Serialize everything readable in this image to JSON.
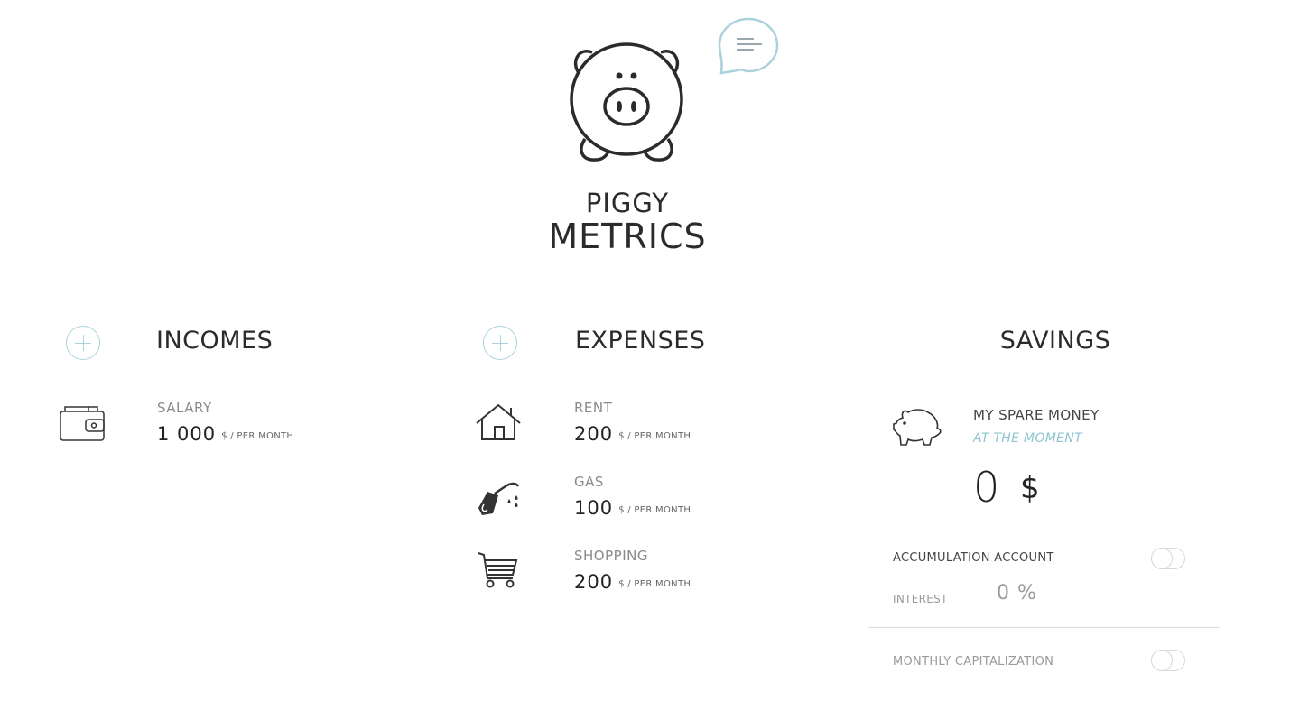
{
  "brand": {
    "line1": "PIGGY",
    "line2": "METRICS"
  },
  "incomes": {
    "title": "INCOMES",
    "items": [
      {
        "name": "SALARY",
        "amount": "1 000",
        "unit": "$ / PER MONTH",
        "icon": "wallet-icon"
      }
    ]
  },
  "expenses": {
    "title": "EXPENSES",
    "items": [
      {
        "name": "RENT",
        "amount": "200",
        "unit": "$ / PER MONTH",
        "icon": "house-icon"
      },
      {
        "name": "GAS",
        "amount": "100",
        "unit": "$ / PER MONTH",
        "icon": "gas-pump-icon"
      },
      {
        "name": "SHOPPING",
        "amount": "200",
        "unit": "$ / PER MONTH",
        "icon": "shopping-cart-icon"
      }
    ]
  },
  "savings": {
    "title": "SAVINGS",
    "label": "MY SPARE MONEY",
    "sublabel": "AT THE MOMENT",
    "amount": "0",
    "currency": "$",
    "accumulation_label": "ACCUMULATION ACCOUNT",
    "accumulation_on": false,
    "interest_label": "INTEREST",
    "interest_value": "0 %",
    "capitalization_label": "MONTHLY CAPITALIZATION",
    "capitalization_on": false
  },
  "colors": {
    "accent": "#a9d2dc",
    "accent_text": "#8cc4d3",
    "text": "#2b2b2b",
    "muted": "#9a9a9a"
  }
}
